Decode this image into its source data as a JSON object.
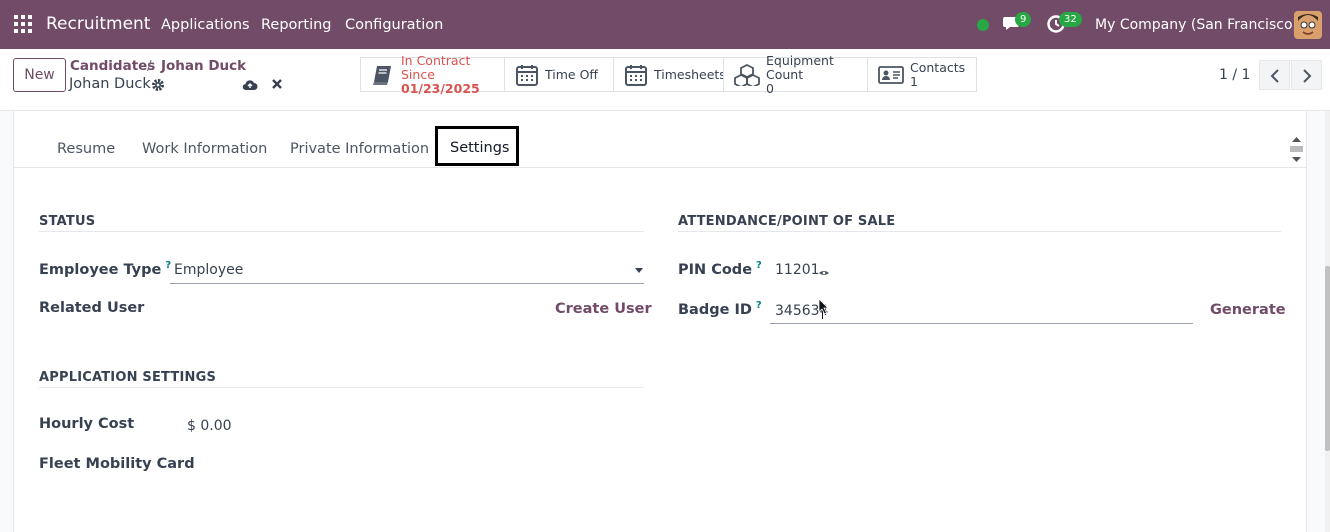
{
  "navbar": {
    "brand": "Recruitment",
    "menu": [
      "Applications",
      "Reporting",
      "Configuration"
    ],
    "chat_badge": "9",
    "activity_badge": "32",
    "company": "My Company (San Francisco)",
    "bg_color": "#714b67"
  },
  "control": {
    "new_label": "New",
    "breadcrumb_parent": "Candidates",
    "breadcrumb_sep": "/",
    "breadcrumb_current": "Johan Duck",
    "record_name": "Johan Duck",
    "pager": "1 / 1"
  },
  "smart_buttons": {
    "contract": {
      "label": "In Contract Since",
      "value": "01/23/2025",
      "color": "#d9534f"
    },
    "time_off": {
      "label": "Time Off"
    },
    "timesheets": {
      "label": "Timesheets"
    },
    "equipment": {
      "label": "Equipment Count",
      "value": "0"
    },
    "contacts": {
      "label": "Contacts",
      "value": "1"
    }
  },
  "tabs": [
    "Resume",
    "Work Information",
    "Private Information",
    "Settings"
  ],
  "status": {
    "title": "STATUS",
    "employee_type_label": "Employee Type",
    "employee_type_value": "Employee",
    "related_user_label": "Related User",
    "create_user": "Create User"
  },
  "attendance": {
    "title": "ATTENDANCE/POINT OF SALE",
    "pin_label": "PIN Code",
    "pin_value": "11201",
    "badge_label": "Badge ID",
    "badge_value": "345634",
    "generate": "Generate"
  },
  "application_settings": {
    "title": "APPLICATION SETTINGS",
    "hourly_cost_label": "Hourly Cost",
    "hourly_cost_value": "$ 0.00",
    "fleet_label": "Fleet Mobility Card"
  },
  "help_mark": "?"
}
